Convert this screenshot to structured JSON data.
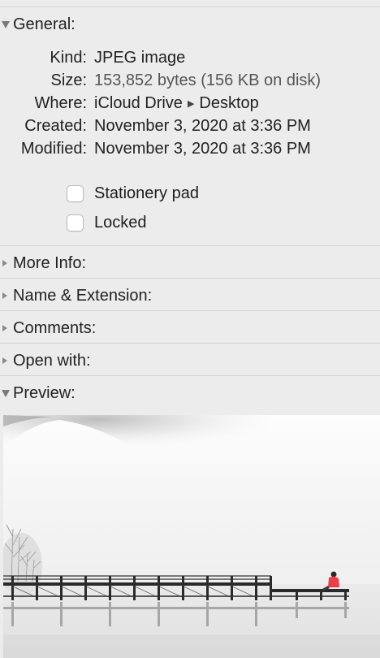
{
  "general": {
    "title": "General:",
    "rows": [
      {
        "label": "Kind:",
        "value": "JPEG image"
      },
      {
        "label": "Size:",
        "value": "153,852 bytes (156 KB on disk)"
      },
      {
        "label": "Where:",
        "value_parts": [
          "iCloud Drive",
          "Desktop"
        ],
        "separator_icon": "right-triangle-icon"
      },
      {
        "label": "Created:",
        "value": "November 3, 2020 at 3:36 PM"
      },
      {
        "label": "Modified:",
        "value": "November 3, 2020 at 3:36 PM"
      }
    ],
    "checkboxes": [
      {
        "label": "Stationery pad",
        "checked": false
      },
      {
        "label": "Locked",
        "checked": false
      }
    ]
  },
  "sections": {
    "more_info": "More Info:",
    "name_extension": "Name & Extension:",
    "comments": "Comments:",
    "open_with": "Open with:",
    "preview": "Preview:"
  },
  "colors": {
    "background": "#ececec",
    "separator": "#d2d2d2",
    "text": "#222222",
    "muted_text": "#555555",
    "jacket": "#e8404a"
  }
}
